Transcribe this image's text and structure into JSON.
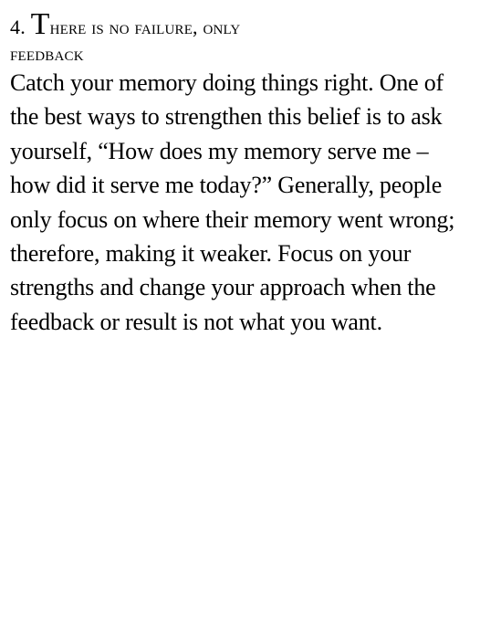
{
  "section": {
    "number": "4.",
    "heading_first_letter": "T",
    "heading_rest_line1": "HERE IS NO FAILURE, ONLY",
    "heading_line2": "FEEDBACK",
    "body": "Catch your memory doing things right. One of the best ways to strengthen this belief is to ask yourself, “How does my memory serve me – how did it serve me today?” Generally, people only focus on where their memory went wrong; therefore, making it weaker. Focus on your strengths and change your approach when the feedback or result is not what you want."
  }
}
